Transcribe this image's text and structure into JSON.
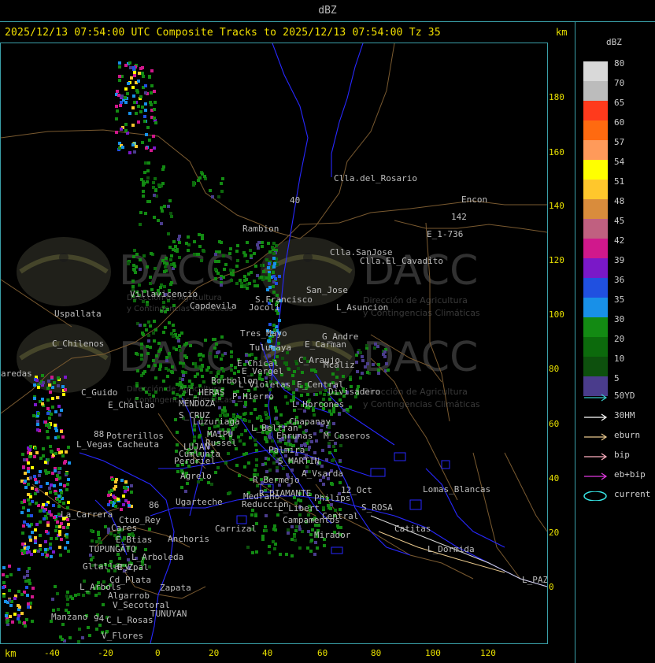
{
  "window": {
    "title": "dBZ"
  },
  "header": {
    "subtitle": "2025/12/13 07:54:00 UTC Composite Tracks to 2025/12/13 07:54:00 Tz 35",
    "km_top": "km",
    "km_bottom": "km"
  },
  "axes": {
    "y_ticks": [
      "180",
      "160",
      "140",
      "120",
      "100",
      "80",
      "60",
      "40",
      "20",
      "0"
    ],
    "x_ticks": [
      "-40",
      "-20",
      "0",
      "20",
      "40",
      "60",
      "80",
      "100",
      "120"
    ]
  },
  "watermark": {
    "brand": "DACC",
    "line1": "Dirección de Agricultura",
    "line2": "y Contingencias Climáticas"
  },
  "legend": {
    "title": "dBZ",
    "scale": [
      {
        "label": "80",
        "color": "#d9d9d9"
      },
      {
        "label": "70",
        "color": "#bcbcbc"
      },
      {
        "label": "65",
        "color": "#ff3a1c"
      },
      {
        "label": "60",
        "color": "#ff6a10"
      },
      {
        "label": "57",
        "color": "#ff9a5a"
      },
      {
        "label": "54",
        "color": "#ffff00"
      },
      {
        "label": "51",
        "color": "#ffc72c"
      },
      {
        "label": "48",
        "color": "#d98c3c"
      },
      {
        "label": "45",
        "color": "#c06080"
      },
      {
        "label": "42",
        "color": "#d0188c"
      },
      {
        "label": "39",
        "color": "#7a18c8"
      },
      {
        "label": "36",
        "color": "#2050e0"
      },
      {
        "label": "35",
        "color": "#1890e8"
      },
      {
        "label": "30",
        "color": "#138a13"
      },
      {
        "label": "20",
        "color": "#0c6a0c"
      },
      {
        "label": "10",
        "color": "#0d500d"
      },
      {
        "label": "5",
        "color": "#4a3c8c"
      }
    ],
    "tracks": [
      {
        "label": "50YD",
        "color": "#38c8c8"
      },
      {
        "label": "30HM",
        "color": "#ffffff"
      },
      {
        "label": "eburn",
        "color": "#e8c88c"
      },
      {
        "label": "bip",
        "color": "#ffb0c0"
      },
      {
        "label": "eb+bip",
        "color": "#e038e0"
      },
      {
        "label": "current",
        "color": "#38e8e8"
      }
    ]
  },
  "places": [
    "Clla.del_Rosario",
    "Encon",
    "142",
    "E_1-736",
    "Rambion",
    "40",
    "Clla.SanJose",
    "Clla.El_Cavadito",
    "Villavicencio",
    "Uspallata",
    "Capdevila",
    "S.Francisco",
    "Jocoli",
    "San_Jose",
    "L_Asuncion",
    "Tres_Mayo",
    "C_Chilenos",
    "Tulumaya",
    "E_Carman",
    "G_Andre",
    "C_Araujo",
    "Mcaliz",
    "E_Chical",
    "E_Vergel",
    "Borbollon",
    "L_Violetas",
    "E_Central",
    "Divisadero",
    "P_Hierro",
    "L_Horcones",
    "L_HERAS",
    "C_Guido",
    "E_Challao",
    "MENDOZA",
    "S_CRUZ",
    "Chapanay",
    "Luzuriaga",
    "L_Beltran",
    "Ehrunas",
    "M_Caseros",
    "Potrerillos",
    "MAIPU",
    "Russel",
    "Cacheuta",
    "L_Vegas",
    "LUJAN",
    "Palmira",
    "Cumlunta",
    "S_MARTIN",
    "Perdriel",
    "Agrelo",
    "R_Bermejo",
    "A_Vsarda",
    "R_DIAMANTE",
    "Lomas_Blancas",
    "12_Oct",
    "Philips",
    "Reduccion",
    "Ugarteche",
    "Medrano",
    "L_Libert",
    "S_ROSA",
    "Campamentos",
    "Central",
    "Catitas",
    "La_Carrera",
    "Ctuo_Rey",
    "Cares",
    "Carrizal",
    "Anchoris",
    "Mirador",
    "L_Dormida",
    "E_Btias",
    "TUPUNGATO",
    "L_Arboleda",
    "Gltallary",
    "E_Zpal",
    "L_PAZ",
    "Cd_Plata",
    "L_Arbols",
    "Zapata",
    "Algarrob",
    "V_Secotoral",
    "TUNUYAN",
    "Manzano",
    "C_L_Rosas",
    "V_Flores",
    "aredas",
    "88",
    "86",
    "94"
  ]
}
